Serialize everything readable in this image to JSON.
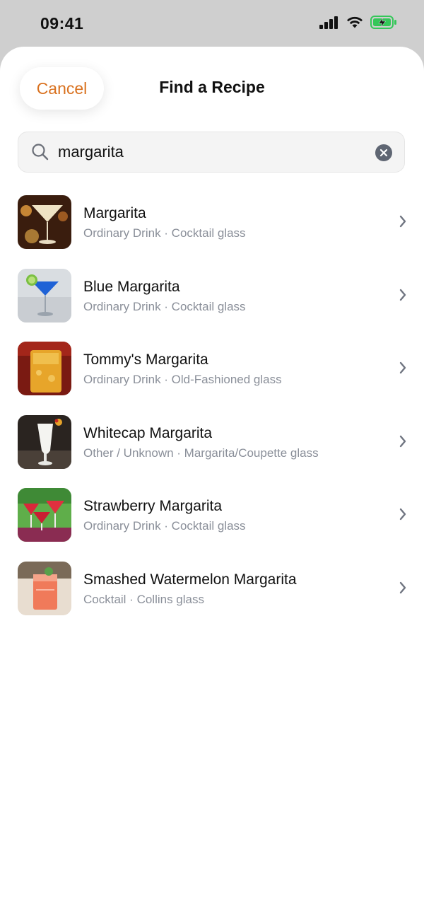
{
  "status": {
    "time": "09:41"
  },
  "header": {
    "cancel_label": "Cancel",
    "title": "Find a Recipe"
  },
  "search": {
    "value": "margarita"
  },
  "results": [
    {
      "name": "Margarita",
      "category": "Ordinary Drink",
      "glass": "Cocktail glass",
      "subtitle": "Ordinary Drink · Cocktail glass"
    },
    {
      "name": "Blue Margarita",
      "category": "Ordinary Drink",
      "glass": "Cocktail glass",
      "subtitle": "Ordinary Drink · Cocktail glass"
    },
    {
      "name": "Tommy's Margarita",
      "category": "Ordinary Drink",
      "glass": "Old-Fashioned glass",
      "subtitle": "Ordinary Drink · Old-Fashioned glass"
    },
    {
      "name": "Whitecap Margarita",
      "category": "Other / Unknown",
      "glass": "Margarita/Coupette glass",
      "subtitle": "Other / Unknown · Margarita/Coupette glass"
    },
    {
      "name": "Strawberry Margarita",
      "category": "Ordinary Drink",
      "glass": "Cocktail glass",
      "subtitle": "Ordinary Drink · Cocktail glass"
    },
    {
      "name": "Smashed Watermelon Margarita",
      "category": "Cocktail",
      "glass": "Collins glass",
      "subtitle": "Cocktail · Collins glass"
    }
  ],
  "colors": {
    "accent": "#d9711f",
    "battery": "#34c759"
  }
}
